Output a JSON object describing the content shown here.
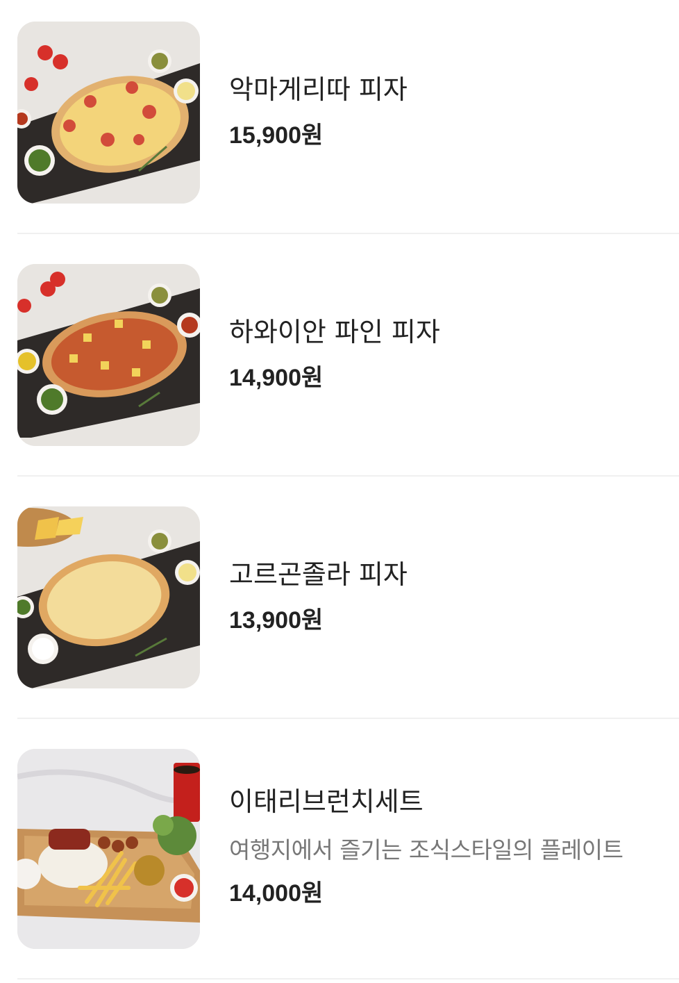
{
  "menu": {
    "items": [
      {
        "name": "악마게리따 피자",
        "description": "",
        "price": "15,900원",
        "image_icon": "pizza-margherita-photo"
      },
      {
        "name": "하와이안 파인 피자",
        "description": "",
        "price": "14,900원",
        "image_icon": "pizza-hawaiian-photo"
      },
      {
        "name": "고르곤졸라 피자",
        "description": "",
        "price": "13,900원",
        "image_icon": "pizza-gorgonzola-photo"
      },
      {
        "name": "이태리브런치세트",
        "description": "여행지에서 즐기는 조식스타일의 플레이트",
        "price": "14,000원",
        "image_icon": "brunch-plate-photo"
      }
    ]
  },
  "colors": {
    "text_primary": "#222222",
    "text_secondary": "#777777",
    "divider": "#f0f0f0"
  }
}
